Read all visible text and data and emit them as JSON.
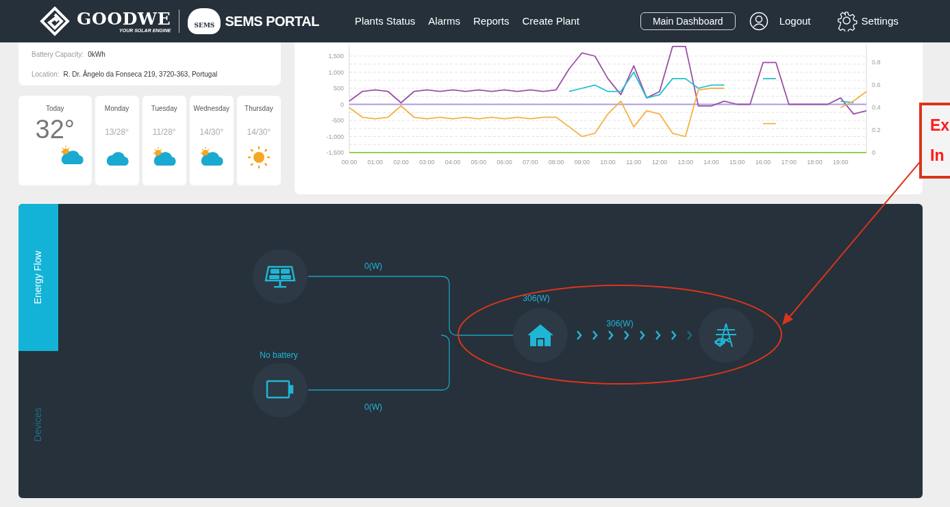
{
  "header": {
    "brand": "GOODWE",
    "tagline": "YOUR SOLAR ENGINE",
    "cloud_badge": "SEMS",
    "portal": "SEMS PORTAL",
    "nav": [
      "Plants Status",
      "Alarms",
      "Reports",
      "Create Plant"
    ],
    "dashboard_button": "Main Dashboard",
    "logout": "Logout",
    "settings": "Settings"
  },
  "plant_info": [
    {
      "label": "Battery Capacity:",
      "value": "0kWh"
    },
    {
      "label": "Location:",
      "value": "R. Dr. Ângelo da Fonseca 219, 3720-363, Portugal"
    }
  ],
  "weather": [
    {
      "day": "Today",
      "temp": "32°",
      "kind": "partly-cloudy",
      "today": true
    },
    {
      "day": "Monday",
      "temp": "13/28°",
      "kind": "cloudy",
      "today": false
    },
    {
      "day": "Tuesday",
      "temp": "11/28°",
      "kind": "partly-cloudy",
      "today": false
    },
    {
      "day": "Wednesday",
      "temp": "14/30°",
      "kind": "partly-cloudy",
      "today": false
    },
    {
      "day": "Thursday",
      "temp": "14/30°",
      "kind": "sunny",
      "today": false
    }
  ],
  "chart": {
    "chart_data": {
      "type": "line",
      "grid": true,
      "x": [
        0,
        0.5,
        1,
        1.5,
        2,
        2.5,
        3,
        3.5,
        4,
        4.5,
        5,
        5.5,
        6,
        6.5,
        7,
        7.5,
        8,
        8.5,
        9,
        9.5,
        10,
        10.5,
        11,
        11.5,
        12,
        12.5,
        13,
        13.5,
        14,
        14.5,
        15,
        15.5,
        16,
        16.5,
        17,
        17.5,
        18,
        18.5,
        19,
        19.5,
        20
      ],
      "series": [
        {
          "color": "#a99be0",
          "values": [
            0,
            0,
            0,
            0,
            0,
            0,
            0,
            0,
            0,
            0,
            0,
            0,
            0,
            0,
            0,
            0,
            0,
            0,
            0,
            0,
            0,
            0,
            0,
            0,
            0,
            0,
            0,
            0,
            0,
            0,
            0,
            0,
            0,
            0,
            0,
            0,
            0,
            0,
            0,
            0,
            0
          ]
        },
        {
          "color": "#9b4fa6",
          "values": [
            100,
            400,
            450,
            400,
            50,
            400,
            450,
            400,
            450,
            400,
            450,
            400,
            450,
            400,
            450,
            400,
            450,
            1100,
            1600,
            1500,
            800,
            300,
            1200,
            200,
            400,
            1800,
            1800,
            -50,
            -50,
            100,
            0,
            0,
            1300,
            1300,
            0,
            0,
            0,
            0,
            200,
            -300,
            -200
          ]
        },
        {
          "color": "#1fbfcf",
          "values": [
            null,
            null,
            null,
            null,
            null,
            null,
            null,
            null,
            null,
            null,
            null,
            null,
            null,
            null,
            null,
            null,
            null,
            400,
            500,
            600,
            400,
            400,
            1000,
            200,
            300,
            800,
            800,
            500,
            600,
            600,
            null,
            null,
            800,
            800,
            null,
            null,
            null,
            null,
            100,
            50,
            null
          ]
        },
        {
          "color": "#f5b041",
          "values": [
            -100,
            -400,
            -450,
            -400,
            -50,
            -400,
            -450,
            -400,
            -450,
            -400,
            -450,
            -400,
            -450,
            -400,
            -450,
            -400,
            -400,
            -700,
            -1000,
            -900,
            -300,
            100,
            -700,
            -200,
            -300,
            -900,
            -1000,
            450,
            500,
            500,
            null,
            null,
            -600,
            -600,
            null,
            null,
            null,
            null,
            -100,
            100,
            400
          ]
        },
        {
          "color": "#8fd14f",
          "values": [
            -1500,
            -1500,
            -1500,
            -1500,
            -1500,
            -1500,
            -1500,
            -1500,
            -1500,
            -1500,
            -1500,
            -1500,
            -1500,
            -1500,
            -1500,
            -1500,
            -1500,
            -1500,
            -1500,
            -1500,
            -1500,
            -1500,
            -1500,
            -1500,
            -1500,
            -1500,
            -1500,
            -1500,
            -1500,
            -1500,
            -1500,
            -1500,
            -1500,
            -1500,
            -1500,
            -1500,
            -1500,
            -1500,
            -1500,
            -1500,
            -1500
          ]
        }
      ],
      "xlim": [
        0,
        20
      ],
      "ylim": [
        -1500,
        1850
      ],
      "xticks": [
        {
          "value": 0,
          "label": "00:00"
        },
        {
          "value": 1,
          "label": "01:00"
        },
        {
          "value": 2,
          "label": "02:00"
        },
        {
          "value": 3,
          "label": "03:00"
        },
        {
          "value": 4,
          "label": "04:00"
        },
        {
          "value": 5,
          "label": "05:00"
        },
        {
          "value": 6,
          "label": "06:00"
        },
        {
          "value": 7,
          "label": "07:00"
        },
        {
          "value": 8,
          "label": "08:00"
        },
        {
          "value": 9,
          "label": "09:00"
        },
        {
          "value": 10,
          "label": "10:00"
        },
        {
          "value": 11,
          "label": "11:00"
        },
        {
          "value": 12,
          "label": "12:00"
        },
        {
          "value": 13,
          "label": "13:00"
        },
        {
          "value": 14,
          "label": "14:00"
        },
        {
          "value": 15,
          "label": "15:00"
        },
        {
          "value": 16,
          "label": "16:00"
        },
        {
          "value": 17,
          "label": "17:00"
        },
        {
          "value": 18,
          "label": "18:00"
        },
        {
          "value": 19,
          "label": "19:00"
        }
      ],
      "yticks": [
        {
          "value": 1500,
          "label": "1,500"
        },
        {
          "value": 1000,
          "label": "1,000"
        },
        {
          "value": 500,
          "label": "500"
        },
        {
          "value": 0,
          "label": "0"
        },
        {
          "value": -500,
          "label": "-500"
        },
        {
          "value": -1000,
          "label": "-1,000"
        },
        {
          "value": -1500,
          "label": "-1,500"
        }
      ],
      "y2ticks": [
        "0.8",
        "0.6",
        "0.4",
        "0.2",
        "0"
      ]
    }
  },
  "side_tabs": [
    {
      "label": "Energy Flow",
      "selected": true
    },
    {
      "label": "Devices",
      "selected": false
    }
  ],
  "energy_flow": {
    "pv_power": "0(W)",
    "battery_status": "No battery",
    "battery_power": "0(W)",
    "load_power": "306(W)",
    "grid_power": "306(W)"
  },
  "annotation": {
    "lines": [
      "Ex",
      "In"
    ]
  }
}
